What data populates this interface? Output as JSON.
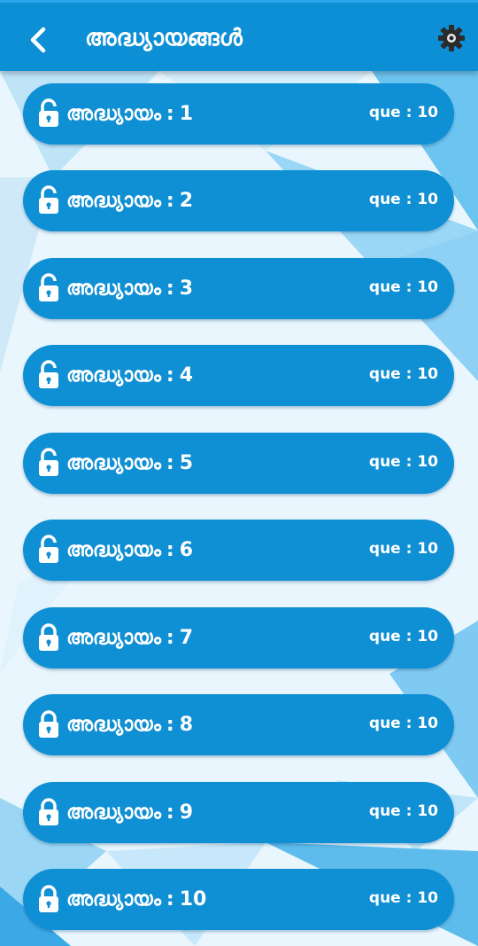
{
  "header": {
    "title": "അദ്ധ്യായങ്ങൾ",
    "back_icon": "chevron-left-icon",
    "settings_icon": "gear-icon"
  },
  "colors": {
    "primary": "#0d8fd6",
    "card": "#0f8fd4",
    "text": "#ffffff",
    "background": "#eaf6fd"
  },
  "chapters": [
    {
      "label": "അദ്ധ്യായം",
      "number": "1",
      "questions": "que : 10",
      "icon": "lock-open-icon"
    },
    {
      "label": "അദ്ധ്യായം",
      "number": "2",
      "questions": "que : 10",
      "icon": "lock-open-icon"
    },
    {
      "label": "അദ്ധ്യായം",
      "number": "3",
      "questions": "que : 10",
      "icon": "lock-open-icon"
    },
    {
      "label": "അദ്ധ്യായം",
      "number": "4",
      "questions": "que : 10",
      "icon": "lock-open-icon"
    },
    {
      "label": "അദ്ധ്യായം",
      "number": "5",
      "questions": "que : 10",
      "icon": "lock-open-icon"
    },
    {
      "label": "അദ്ധ്യായം",
      "number": "6",
      "questions": "que : 10",
      "icon": "lock-open-icon"
    },
    {
      "label": "അദ്ധ്യായം",
      "number": "7",
      "questions": "que : 10",
      "icon": "lock-icon"
    },
    {
      "label": "അദ്ധ്യായം",
      "number": "8",
      "questions": "que : 10",
      "icon": "lock-icon"
    },
    {
      "label": "അദ്ധ്യായം",
      "number": "9",
      "questions": "que : 10",
      "icon": "lock-icon"
    },
    {
      "label": "അദ്ധ്യായം",
      "number": "10",
      "questions": "que : 10",
      "icon": "lock-icon"
    }
  ]
}
